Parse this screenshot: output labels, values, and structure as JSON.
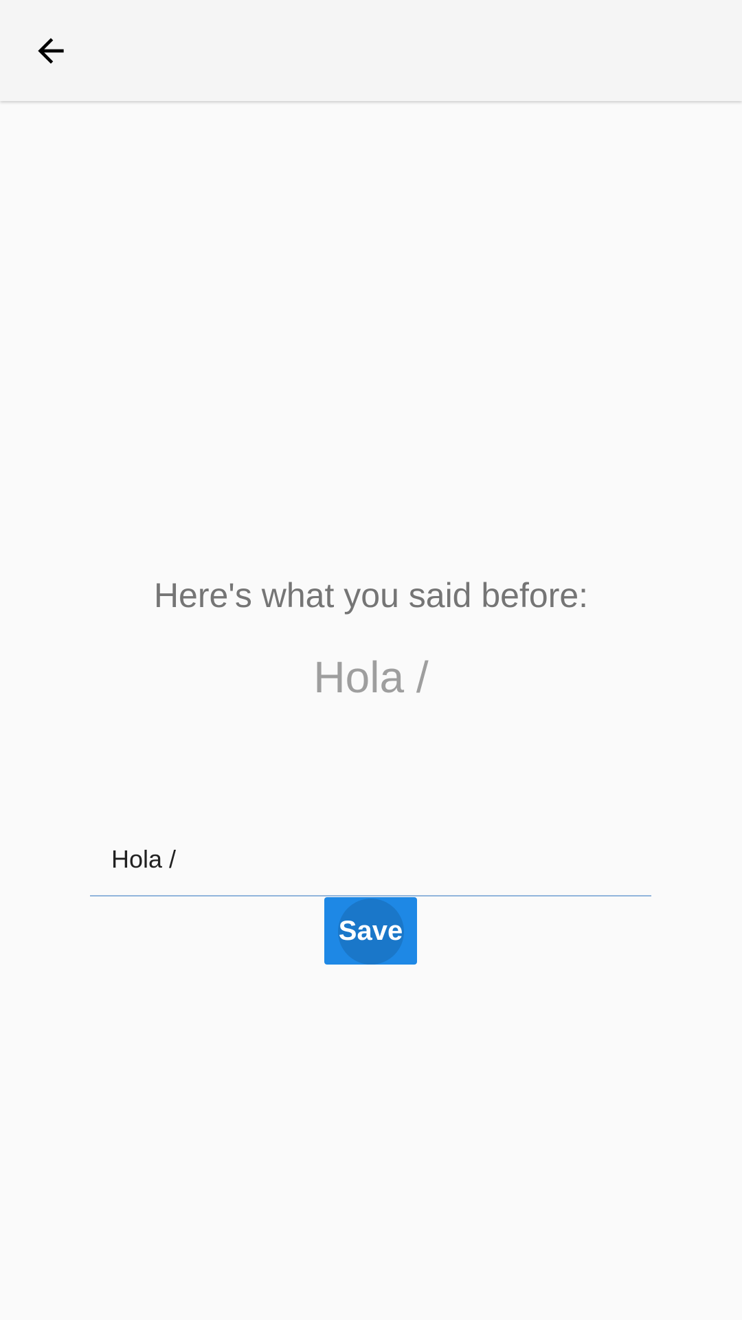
{
  "app_bar": {
    "back_icon": "arrow-back-icon"
  },
  "main": {
    "prompt_label": "Here's what you said before:",
    "previous_value": "Hola /",
    "input": {
      "value": "Hola /",
      "placeholder": ""
    },
    "save_label": "Save"
  },
  "colors": {
    "accent": "#1e88e5",
    "underline": "#90b4dc",
    "background": "#fafafa",
    "app_bar": "#f5f5f5"
  }
}
